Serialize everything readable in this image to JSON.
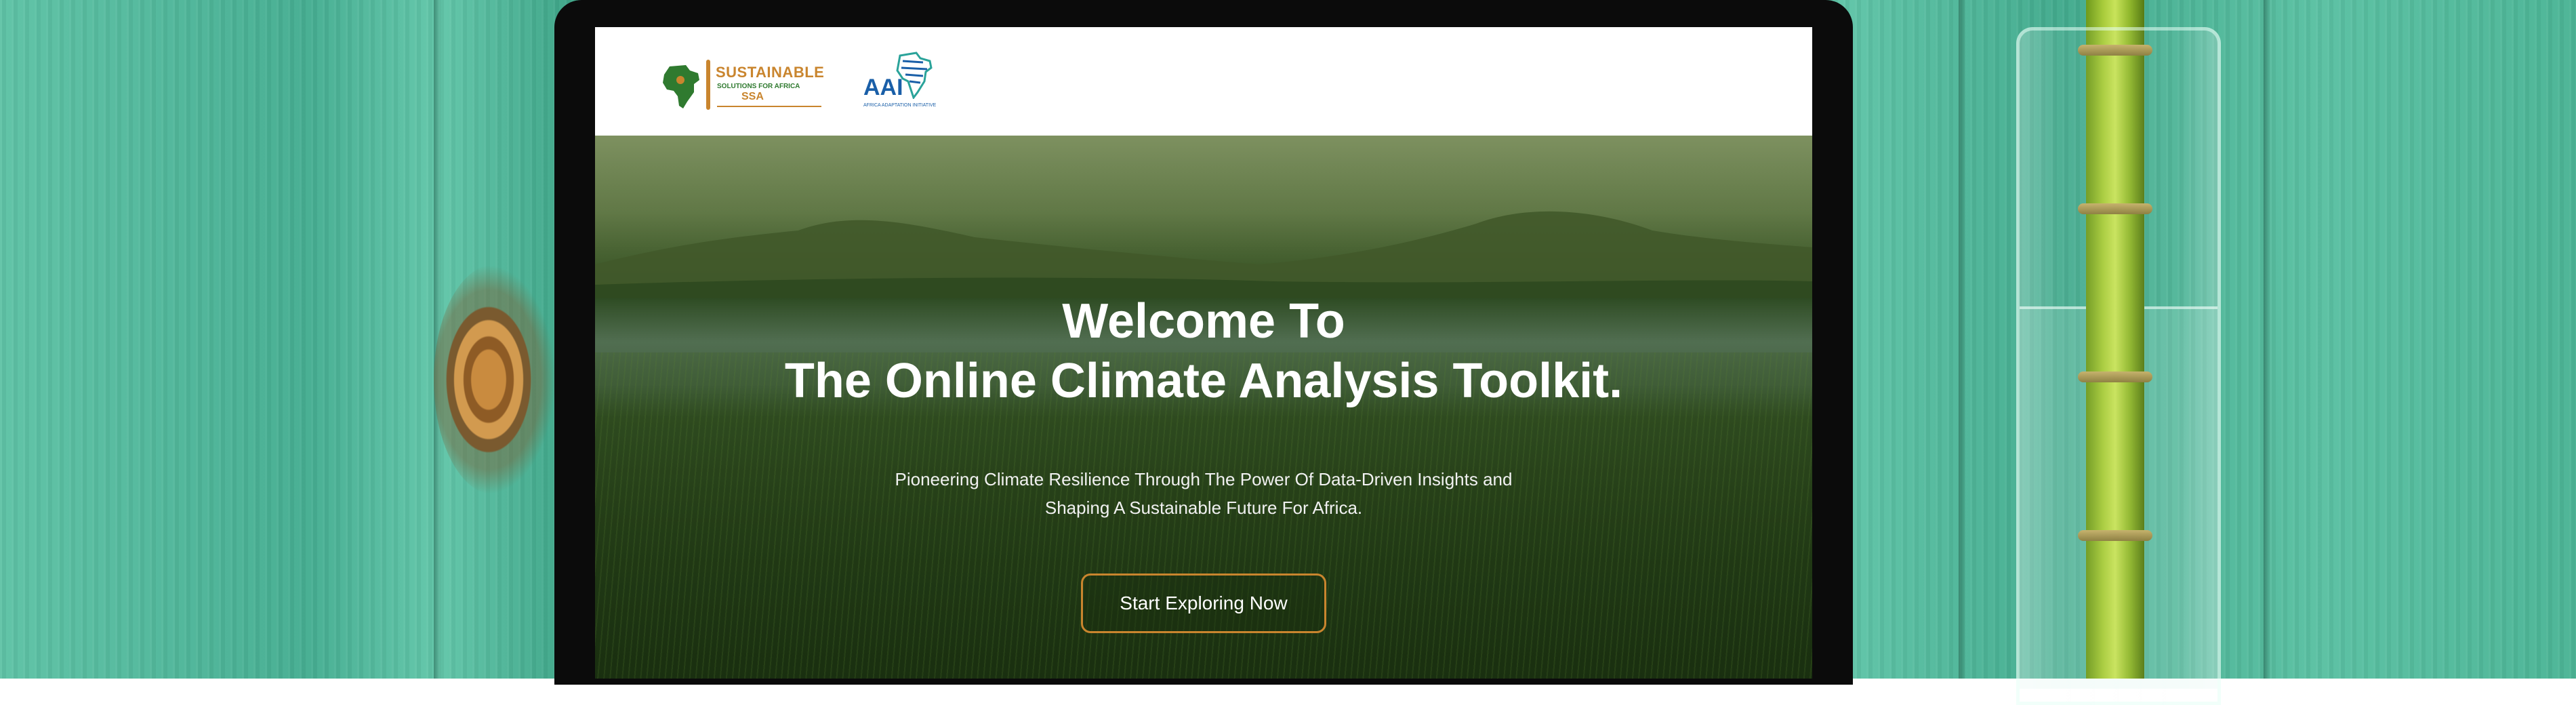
{
  "header": {
    "ssa_logo": {
      "line1": "SUSTAINABLE",
      "line2": "SOLUTIONS FOR AFRICA",
      "line3": "SSA"
    },
    "aai_logo": {
      "name": "AAI",
      "tagline": "AFRICA ADAPTATION INITIATIVE"
    }
  },
  "hero": {
    "title_line1": "Welcome To",
    "title_line2": "The Online Climate Analysis Toolkit.",
    "subtitle_line1": "Pioneering Climate Resilience Through The Power Of Data-Driven  Insights and",
    "subtitle_line2": "Shaping A Sustainable Future For Africa.",
    "cta_label": "Start Exploring Now"
  },
  "colors": {
    "accent": "#c9852e",
    "ssa_green": "#2f7a2f",
    "aai_blue": "#1a5fa8"
  }
}
